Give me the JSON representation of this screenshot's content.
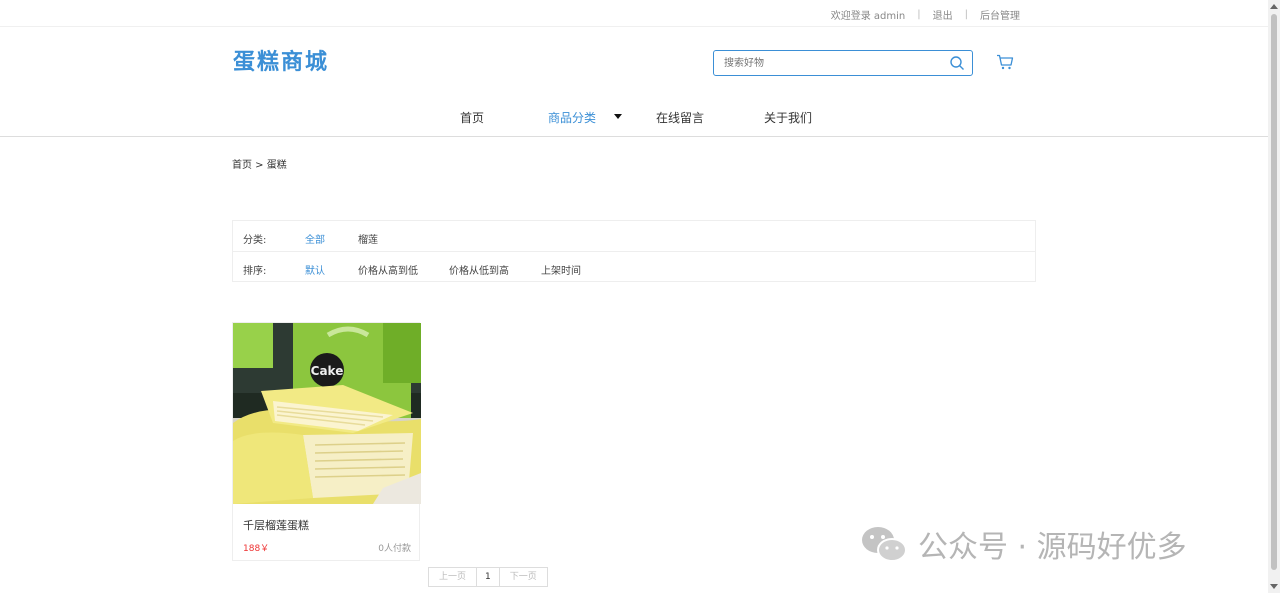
{
  "topbar": {
    "welcome": "欢迎登录 admin",
    "logout": "退出",
    "admin": "后台管理"
  },
  "header": {
    "logo": "蛋糕商城",
    "search_placeholder": "搜索好物"
  },
  "nav": {
    "home": "首页",
    "category": "商品分类",
    "message": "在线留言",
    "about": "关于我们"
  },
  "breadcrumb": "首页 > 蛋糕",
  "filter": {
    "category_label": "分类:",
    "category_all": "全部",
    "category_1": "榴莲",
    "sort_label": "排序:",
    "sort_default": "默认",
    "sort_high": "价格从高到低",
    "sort_low": "价格从低到高",
    "sort_time": "上架时间"
  },
  "products": [
    {
      "name": "千层榴莲蛋糕",
      "price": "188￥",
      "sales": "0人付款"
    }
  ],
  "pagination": {
    "prev": "上一页",
    "current": "1",
    "next": "下一页"
  },
  "watermark": "公众号 · 源码好优多",
  "colors": {
    "accent": "#3b8fd6",
    "price": "#e33333"
  }
}
